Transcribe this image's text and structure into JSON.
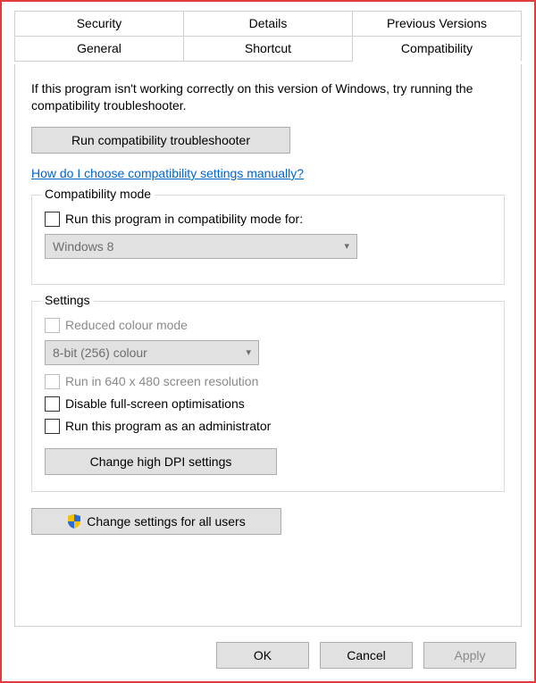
{
  "tabs": {
    "row1": [
      "Security",
      "Details",
      "Previous Versions"
    ],
    "row2": [
      "General",
      "Shortcut",
      "Compatibility"
    ],
    "active": "Compatibility"
  },
  "intro": "If this program isn't working correctly on this version of Windows, try running the compatibility troubleshooter.",
  "troubleshooter_btn": "Run compatibility troubleshooter",
  "help_link": "How do I choose compatibility settings manually?",
  "compat_mode": {
    "legend": "Compatibility mode",
    "checkbox_label": "Run this program in compatibility mode for:",
    "dropdown_value": "Windows 8"
  },
  "settings": {
    "legend": "Settings",
    "reduced_colour": "Reduced colour mode",
    "colour_dropdown": "8-bit (256) colour",
    "run_640": "Run in 640 x 480 screen resolution",
    "disable_fullscreen": "Disable full-screen optimisations",
    "run_admin": "Run this program as an administrator",
    "dpi_btn": "Change high DPI settings"
  },
  "all_users_btn": "Change settings for all users",
  "buttons": {
    "ok": "OK",
    "cancel": "Cancel",
    "apply": "Apply"
  }
}
